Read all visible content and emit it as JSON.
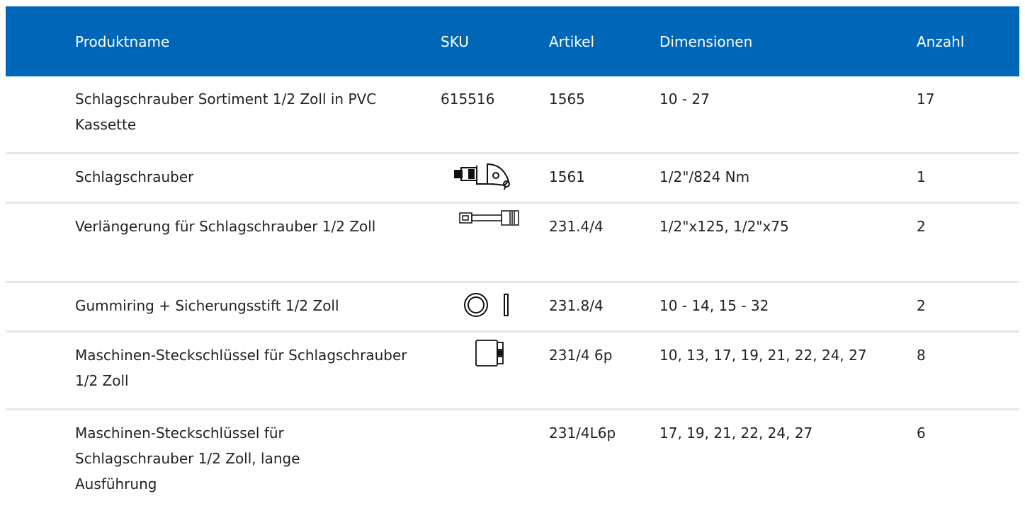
{
  "table": {
    "headers": {
      "name": "Produktname",
      "sku": "SKU",
      "article": "Artikel",
      "dimensions": "Dimensionen",
      "count": "Anzahl"
    },
    "rows": [
      {
        "name": "Schlagschrauber Sortiment 1/2 Zoll in PVC Kassette",
        "sku": "615516",
        "article": "1565",
        "dimensions": "10 - 27",
        "count": "17",
        "icon": ""
      },
      {
        "name": "Schlagschrauber",
        "sku": "",
        "article": "1561",
        "dimensions": "1/2\"/824 Nm",
        "count": "1",
        "icon": "impact-wrench-icon"
      },
      {
        "name": "Verlängerung für Schlagschrauber 1/2 Zoll",
        "sku": "",
        "article": "231.4/4",
        "dimensions": "1/2\"x125, 1/2\"x75",
        "count": "2",
        "icon": "extension-bar-icon"
      },
      {
        "name": "Gummiring + Sicherungsstift 1/2 Zoll",
        "sku": "",
        "article": "231.8/4",
        "dimensions": "10 - 14, 15 - 32",
        "count": "2",
        "icon": "rubber-ring-pin-icon"
      },
      {
        "name": "Maschinen-Steckschlüssel für Schlagschrauber 1/2 Zoll",
        "sku": "",
        "article": "231/4 6p",
        "dimensions": "10, 13, 17, 19, 21, 22, 24, 27",
        "count": "8",
        "icon": "socket-icon"
      },
      {
        "name": "Maschinen-Steckschlüssel für Schlagschrauber 1/2 Zoll, lange Ausführung",
        "sku": "",
        "article": "231/4L6p",
        "dimensions": "17, 19, 21, 22, 24, 27",
        "count": "6",
        "icon": ""
      }
    ]
  },
  "colors": {
    "header_bg": "#0067b8",
    "header_text": "#ffffff",
    "row_divider": "#e7e7e7"
  }
}
